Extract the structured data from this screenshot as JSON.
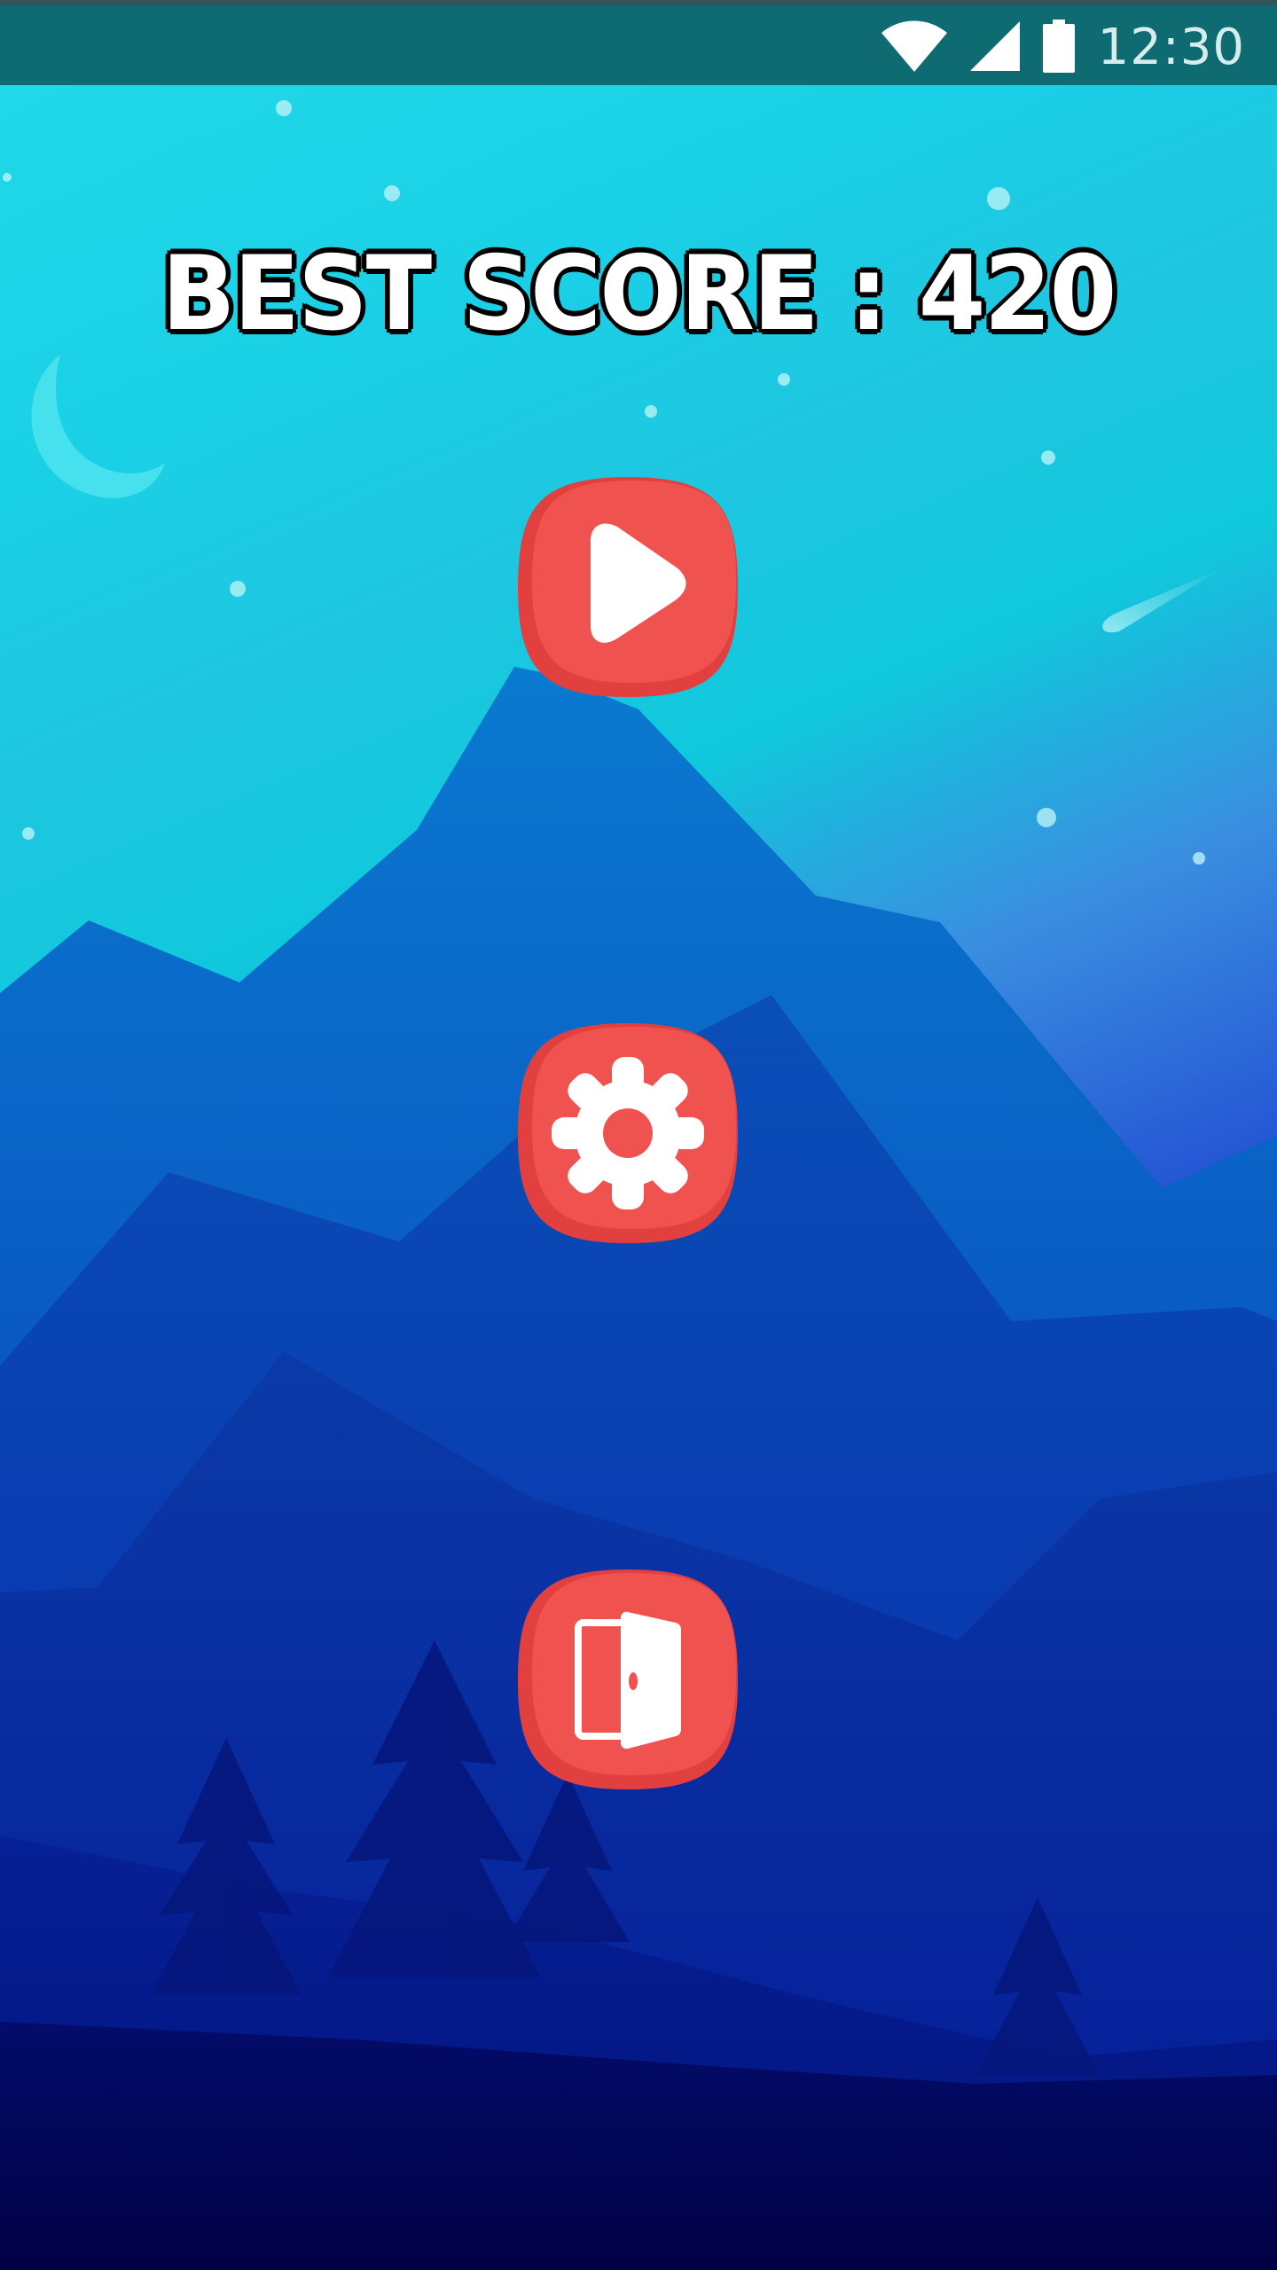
{
  "status_bar": {
    "time": "12:30",
    "icons": [
      "wifi-icon",
      "cellular-signal-icon",
      "battery-icon"
    ]
  },
  "header": {
    "best_score_label": "BEST SCORE : 420"
  },
  "menu": {
    "buttons": [
      {
        "name": "play-button",
        "icon": "play-icon"
      },
      {
        "name": "settings-button",
        "icon": "gear-icon"
      },
      {
        "name": "exit-button",
        "icon": "door-exit-icon"
      }
    ]
  },
  "colors": {
    "status_bar": "#0f6b72",
    "button_fill": "#f0524f",
    "button_shadow": "#e2403f",
    "sky_top": "#1cd6e6",
    "sky_bottom": "#000046"
  }
}
